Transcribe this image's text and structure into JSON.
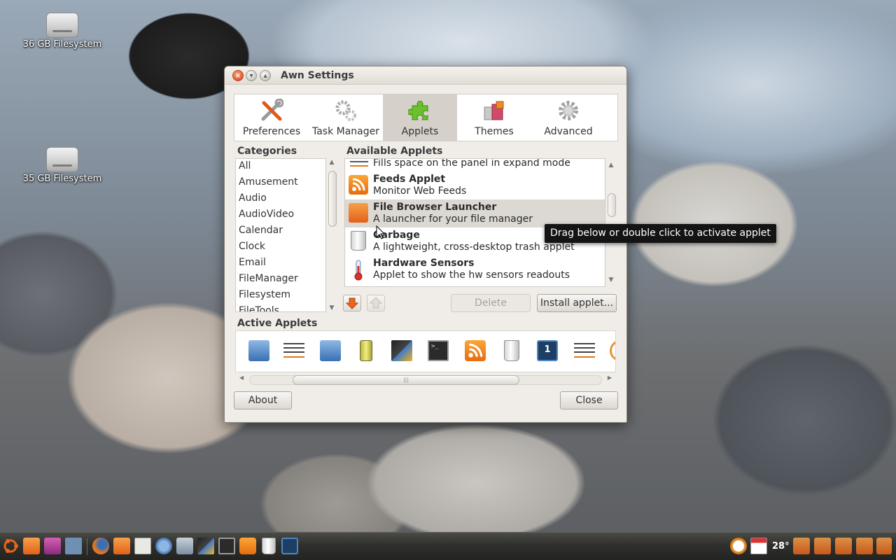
{
  "desktop": {
    "icons": [
      {
        "label": "36 GB Filesystem"
      },
      {
        "label": "35 GB Filesystem"
      }
    ]
  },
  "window": {
    "title": "Awn Settings",
    "tabs": [
      {
        "label": "Preferences",
        "icon": "wrench-screwdriver-icon"
      },
      {
        "label": "Task Manager",
        "icon": "gears-icon"
      },
      {
        "label": "Applets",
        "icon": "puzzle-piece-icon",
        "active": true
      },
      {
        "label": "Themes",
        "icon": "gift-bags-icon"
      },
      {
        "label": "Advanced",
        "icon": "gear-icon"
      }
    ],
    "categories": {
      "heading": "Categories",
      "items": [
        "All",
        "Amusement",
        "Audio",
        "AudioVideo",
        "Calendar",
        "Clock",
        "Email",
        "FileManager",
        "Filesystem",
        "FileTools"
      ]
    },
    "available": {
      "heading": "Available Applets",
      "rows": [
        {
          "name": "",
          "desc": "Fills space on the panel in expand mode",
          "icon": "expander-icon"
        },
        {
          "name": "Feeds Applet",
          "desc": "Monitor Web Feeds",
          "icon": "rss-icon"
        },
        {
          "name": "File Browser Launcher",
          "desc": "A launcher for your file manager",
          "icon": "folder-icon",
          "selected": true
        },
        {
          "name": "Garbage",
          "desc": "A lightweight, cross-desktop trash applet",
          "icon": "trash-icon"
        },
        {
          "name": "Hardware Sensors",
          "desc": "Applet to show the hw sensors readouts",
          "icon": "thermometer-icon"
        }
      ],
      "delete_label": "Delete",
      "install_label": "Install applet..."
    },
    "active": {
      "heading": "Active Applets",
      "icons": [
        "launcher-icon",
        "separator-icon",
        "launcher-icon",
        "battery-icon",
        "media-icon",
        "terminal-icon",
        "rss-icon",
        "trash-icon",
        "workspace-icon",
        "separator-icon",
        "clock-icon"
      ]
    },
    "about_label": "About",
    "close_label": "Close"
  },
  "tooltip": "Drag below or double click to activate applet",
  "taskbar": {
    "temperature": "28°"
  },
  "colors": {
    "accent_orange": "#e3611a",
    "window_bg": "#f0ede8",
    "selection": "#d5d1ca"
  }
}
